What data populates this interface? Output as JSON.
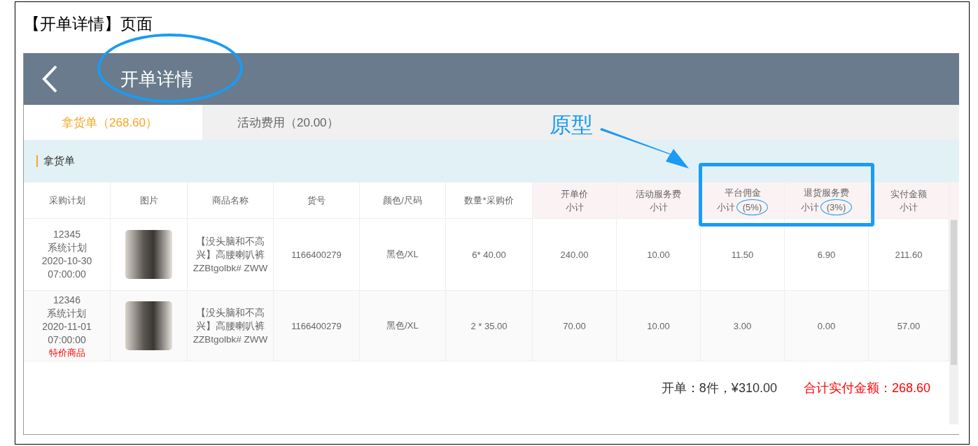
{
  "document_title": "【开单详情】页面",
  "app": {
    "title": "开单详情",
    "title_circled": true,
    "tabs": [
      {
        "label": "拿货单（268.60）",
        "selected": true
      },
      {
        "label": "活动费用（20.00）",
        "selected": false
      }
    ],
    "section_title": "拿货单",
    "table": {
      "columns": [
        {
          "title": "采购计划",
          "tinted": false
        },
        {
          "title": "图片",
          "tinted": false
        },
        {
          "title": "商品名称",
          "tinted": false
        },
        {
          "title": "货号",
          "tinted": false
        },
        {
          "title": "颜色/尺码",
          "tinted": false
        },
        {
          "title": "数量*采购价",
          "tinted": false
        },
        {
          "title": "开单价",
          "sub": "小计",
          "tinted": true
        },
        {
          "title": "活动服务费",
          "sub": "小计",
          "tinted": true
        },
        {
          "title": "平台佣金",
          "sub": "小计",
          "rate": "(5%)",
          "rate_circled": true,
          "tinted": true
        },
        {
          "title": "退货服务费",
          "sub": "小计",
          "rate": "(3%)",
          "rate_circled": true,
          "tinted": true
        },
        {
          "title": "实付金额",
          "sub": "小计",
          "tinted": true
        }
      ],
      "rows": [
        {
          "plan": [
            "12345",
            "系统计划",
            "2020-10-30",
            "07:00:00"
          ],
          "name": [
            "【没头脑和不高",
            "兴】高腰喇叭裤",
            "ZZBtgolbk# ZWW"
          ],
          "sku": "1166400279",
          "spec": "黑色/XL",
          "qty_price": "6* 40.00",
          "values": [
            "240.00",
            "10.00",
            "11.50",
            "6.90",
            "211.60"
          ]
        },
        {
          "plan": [
            "12346",
            "系统计划",
            "2020-11-01",
            "07:00:00"
          ],
          "tag": "特价商品",
          "name": [
            "【没头脑和不高",
            "兴】高腰喇叭裤",
            "ZZBtgolbk# ZWW"
          ],
          "sku": "1166400279",
          "spec": "黑色/XL",
          "qty_price": "2 * 35.00",
          "values": [
            "70.00",
            "10.00",
            "3.00",
            "0.00",
            "57.00"
          ]
        }
      ]
    },
    "footer": {
      "summary": "开单：8件，¥310.00",
      "total": "合计实付金额：268.60"
    }
  },
  "annotations": [
    {
      "kind": "label",
      "text": "原型"
    },
    {
      "kind": "arrow"
    },
    {
      "kind": "box"
    }
  ]
}
